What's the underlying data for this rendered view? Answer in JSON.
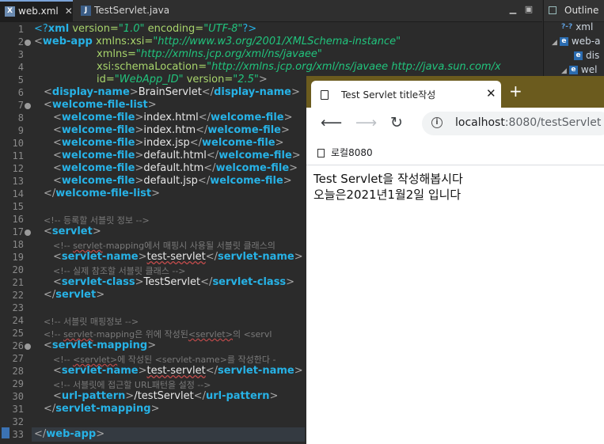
{
  "editor": {
    "tabs": [
      {
        "label": "web.xml",
        "icon": "xml-file-icon",
        "active": true
      },
      {
        "label": "TestServlet.java",
        "icon": "java-file-icon",
        "active": false
      }
    ],
    "lines": [
      {
        "n": "1",
        "fold": false
      },
      {
        "n": "2",
        "fold": true
      },
      {
        "n": "3",
        "fold": false
      },
      {
        "n": "4",
        "fold": false
      },
      {
        "n": "5",
        "fold": false
      },
      {
        "n": "6",
        "fold": false
      },
      {
        "n": "7",
        "fold": true
      },
      {
        "n": "8",
        "fold": false
      },
      {
        "n": "9",
        "fold": false
      },
      {
        "n": "10",
        "fold": false
      },
      {
        "n": "11",
        "fold": false
      },
      {
        "n": "12",
        "fold": false
      },
      {
        "n": "13",
        "fold": false
      },
      {
        "n": "14",
        "fold": false
      },
      {
        "n": "15",
        "fold": false
      },
      {
        "n": "16",
        "fold": false
      },
      {
        "n": "17",
        "fold": true
      },
      {
        "n": "18",
        "fold": false
      },
      {
        "n": "19",
        "fold": false
      },
      {
        "n": "20",
        "fold": false
      },
      {
        "n": "21",
        "fold": false
      },
      {
        "n": "22",
        "fold": false
      },
      {
        "n": "23",
        "fold": false
      },
      {
        "n": "24",
        "fold": false
      },
      {
        "n": "25",
        "fold": false
      },
      {
        "n": "26",
        "fold": true
      },
      {
        "n": "27",
        "fold": false
      },
      {
        "n": "28",
        "fold": false
      },
      {
        "n": "29",
        "fold": false
      },
      {
        "n": "30",
        "fold": false
      },
      {
        "n": "31",
        "fold": false
      },
      {
        "n": "32",
        "fold": false
      },
      {
        "n": "33",
        "fold": false
      }
    ],
    "xml": {
      "decl_open": "<?",
      "decl_xml": "xml",
      "decl_version_attr": " version=",
      "decl_version_val": "\"1.0\"",
      "decl_encoding_attr": " encoding=",
      "decl_encoding_val": "\"UTF-8\"",
      "decl_close": "?>",
      "webapp_tag": "web-app",
      "xmlns_xsi_attr": "xmlns:xsi=",
      "xmlns_xsi_val": "\"http://www.w3.org/2001/XMLSchema-instance\"",
      "xmlns_attr": "xmlns=",
      "xmlns_val": "\"http://xmlns.jcp.org/xml/ns/javaee\"",
      "schema_attr": "xsi:schemaLocation=",
      "schema_val": "\"http://xmlns.jcp.org/xml/ns/javaee http://java.sun.com/x",
      "id_attr": "id=",
      "id_val": "\"WebApp_ID\"",
      "version_attr": " version=",
      "version_val": "\"2.5\"",
      "display_name_tag": "display-name",
      "display_name_val": "BrainServlet",
      "welcome_list_tag": "welcome-file-list",
      "welcome_file_tag": "welcome-file",
      "welcome_files": [
        "index.html",
        "index.htm",
        "index.jsp",
        "default.html",
        "default.htm",
        "default.jsp"
      ],
      "comment_register": "<!-- 등록할 서블릿 정보 -->",
      "servlet_tag": "servlet",
      "comment_mapping_use_a": "<!-- ",
      "comment_mapping_use_b": "servlet",
      "comment_mapping_use_c": "-mapping에서 매핑시 사용될 서블릿 클래스의",
      "servlet_name_tag": "servlet-name",
      "servlet_name_val": "test-servlet",
      "comment_real_class": "<!-- 실제 참조할 서블릿 클래스 -->",
      "servlet_class_tag": "servlet-class",
      "servlet_class_val": "TestServlet",
      "comment_mapping_info": "<!-- 서블릿 매핑정보 -->",
      "comment_mapping_desc_a": "<!-- ",
      "comment_mapping_desc_b": "servlet",
      "comment_mapping_desc_c": "-mapping은 위에 작성된",
      "comment_mapping_desc_d": "<servlet>",
      "comment_mapping_desc_e": "의 <servl",
      "servlet_mapping_tag": "servlet-mapping",
      "comment_name_a": "<!-- ",
      "comment_name_b": "<servlet>",
      "comment_name_c": "에 작성된 <servlet-name>를 작성한다 -",
      "comment_url": "<!-- 서블릿에 접근할 URL패턴을 설정 -->",
      "url_pattern_tag": "url-pattern",
      "url_pattern_val": "/testServlet"
    }
  },
  "outline": {
    "title": "Outline",
    "items": [
      {
        "label": "xml",
        "icon": "xml-decl-icon"
      },
      {
        "label": "web-a",
        "icon": "element-icon"
      },
      {
        "label": "dis",
        "icon": "element-icon"
      },
      {
        "label": "wel",
        "icon": "element-icon"
      }
    ]
  },
  "browser": {
    "tab_title": "Test Servlet title작성",
    "url_host": "localhost",
    "url_rest": ":8080/testServlet",
    "bookmark": "로컬8080",
    "page_lines": [
      "Test Servlet을 작성해봅시다",
      "오늘은2021년1월2일 입니다"
    ]
  },
  "colors": {
    "tag": "#27b2e6",
    "attr_name": "#a8d56c",
    "attr_value": "#21c47d",
    "comment": "#7a7a7a",
    "browser_frame": "#6b5b1e"
  }
}
